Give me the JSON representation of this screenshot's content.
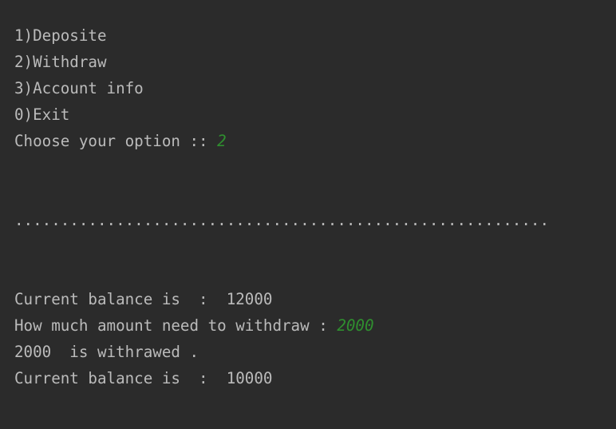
{
  "console": {
    "menu": [
      "1)Deposite",
      "2)Withdraw",
      "3)Account info",
      "0)Exit"
    ],
    "option_prompt": "Choose your option :: ",
    "option_input": "2",
    "separator": "..........................................................",
    "balance_before": "Current balance is  :  12000",
    "withdraw_prompt": "How much amount need to withdraw : ",
    "withdraw_input": "2000",
    "withdraw_result": "2000  is withrawed .",
    "balance_after": "Current balance is  :  10000"
  },
  "colors": {
    "background": "#2b2b2b",
    "text": "#bbbbbb",
    "user_input": "#2f8f2f"
  }
}
